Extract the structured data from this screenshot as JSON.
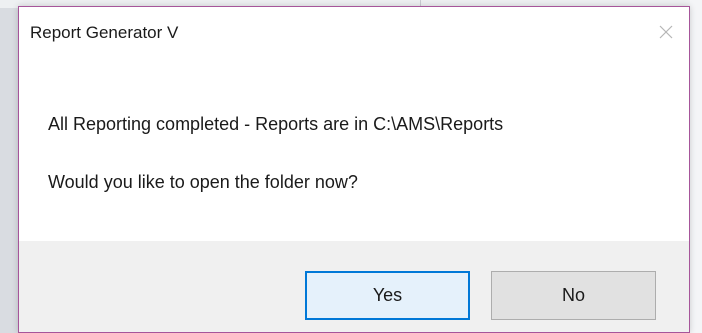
{
  "dialog": {
    "title": "Report Generator V",
    "close_icon": "close-icon",
    "message_line_1": "All Reporting completed - Reports are in C:\\AMS\\Reports",
    "message_line_2": "Would you like to open the folder now?",
    "buttons": {
      "yes_label": "Yes",
      "no_label": "No"
    },
    "colors": {
      "border": "#a6559a",
      "default_button_border": "#0078d7",
      "footer_background": "#f0f0f0"
    }
  }
}
